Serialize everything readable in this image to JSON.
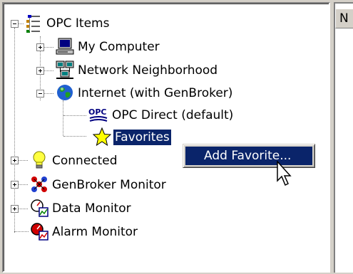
{
  "tree": {
    "root": {
      "label": "OPC Items",
      "icon": "opc-items-tree-icon"
    },
    "items": [
      {
        "label": "My Computer",
        "icon": "computer-icon"
      },
      {
        "label": "Network Neighborhood",
        "icon": "network-neighborhood-icon"
      },
      {
        "label": "Internet (with GenBroker)",
        "icon": "globe-icon"
      },
      {
        "label": "OPC Direct (default)",
        "icon": "opc-logo-icon"
      },
      {
        "label": "Favorites",
        "icon": "star-icon"
      },
      {
        "label": "Connected",
        "icon": "lightbulb-icon"
      },
      {
        "label": "GenBroker Monitor",
        "icon": "genbroker-monitor-icon"
      },
      {
        "label": "Data Monitor",
        "icon": "data-monitor-icon"
      },
      {
        "label": "Alarm Monitor",
        "icon": "alarm-monitor-icon"
      }
    ]
  },
  "right_panel": {
    "header_label": "N"
  },
  "context_menu": {
    "items": [
      {
        "label": "Add Favorite..."
      }
    ]
  },
  "opc_logo_text": "OPC",
  "colors": {
    "selection": "#0a246a",
    "window_bg": "#d4d0c8",
    "panel_bg": "#ffffff"
  }
}
